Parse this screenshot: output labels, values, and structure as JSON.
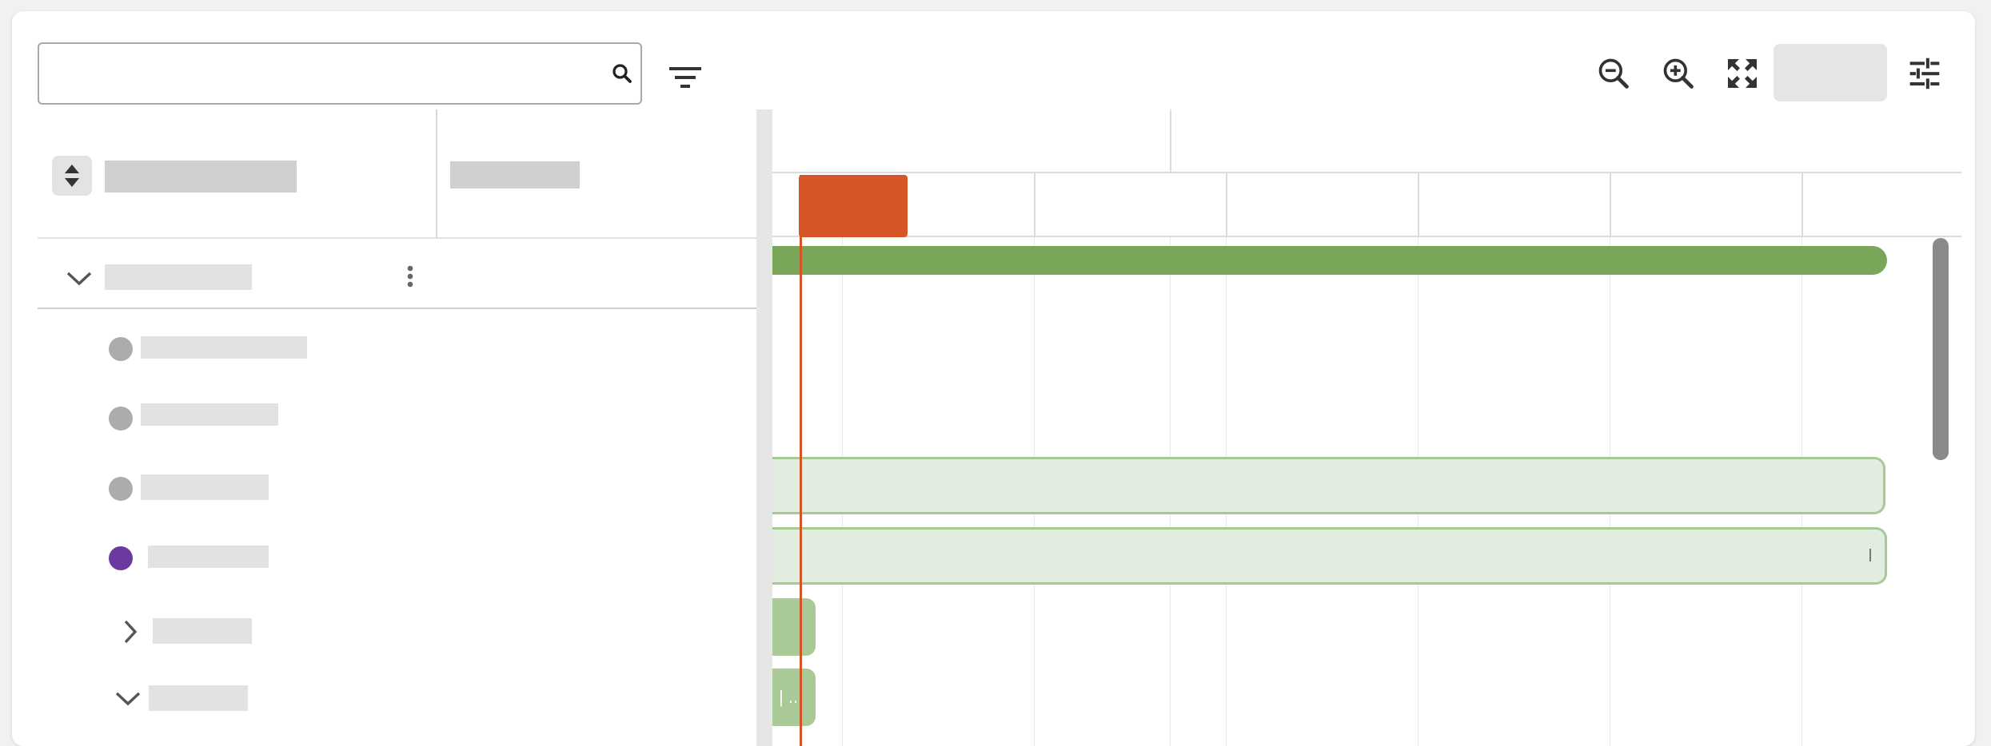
{
  "app": {
    "search": {
      "value": "",
      "placeholder": ""
    },
    "toolbar": {
      "icons": [
        "search-icon",
        "filter-icon",
        "zoom-out-icon",
        "zoom-in-icon",
        "fullscreen-icon",
        "settings-sliders-icon"
      ]
    },
    "grid": {
      "sort_icon": "sort-updown-icon",
      "group_toggle_icon": "chevron-down-icon",
      "row_menu_icon": "more-vertical-icon",
      "rows": [
        {
          "status": "gray"
        },
        {
          "status": "gray"
        },
        {
          "status": "gray"
        },
        {
          "status": "purple"
        },
        {
          "toggle": "chevron-right-icon"
        },
        {
          "toggle": "chevron-down-icon"
        }
      ]
    },
    "timeline": {
      "bar_labels": {
        "small_bar_text": "| ..."
      }
    },
    "colors": {
      "today_marker": "#d65527",
      "summary_bar": "#7aa65a",
      "task_bar_fill": "#e1edde",
      "task_bar_border": "#a7c996",
      "small_bar": "#a9c996",
      "status_gray": "#acacac",
      "status_purple": "#6a3a9e"
    }
  }
}
